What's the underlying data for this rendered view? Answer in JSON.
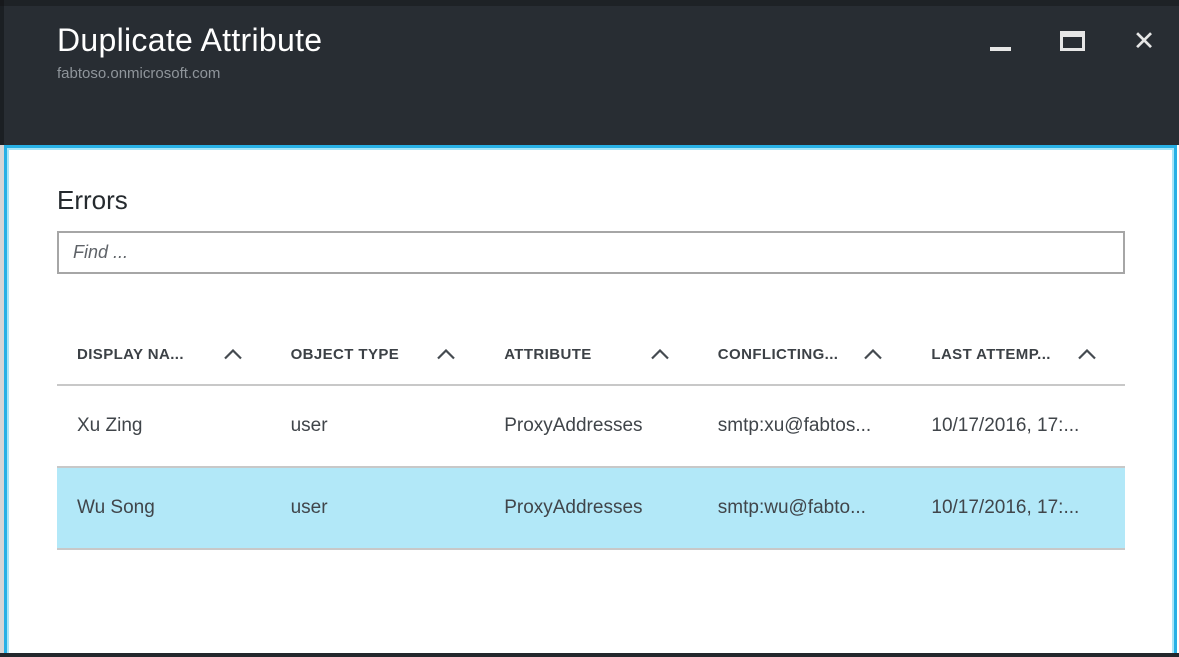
{
  "window": {
    "title": "Duplicate Attribute",
    "subtitle": "fabtoso.onmicrosoft.com",
    "controls": {
      "minimize": "minimize-icon",
      "maximize": "maximize-icon",
      "close": "close-icon",
      "close_glyph": "✕"
    }
  },
  "panel": {
    "heading": "Errors",
    "search": {
      "placeholder": "Find ...",
      "value": ""
    }
  },
  "table": {
    "columns": [
      {
        "label": "DISPLAY NA...",
        "sort_icon": "chevron-up-icon"
      },
      {
        "label": "OBJECT TYPE",
        "sort_icon": "chevron-up-icon"
      },
      {
        "label": "ATTRIBUTE",
        "sort_icon": "chevron-up-icon"
      },
      {
        "label": "CONFLICTING...",
        "sort_icon": "chevron-up-icon"
      },
      {
        "label": "LAST ATTEMP...",
        "sort_icon": "chevron-up-icon"
      }
    ],
    "rows": [
      {
        "display_name": "Xu Zing",
        "object_type": "user",
        "attribute": "ProxyAddresses",
        "conflicting_value": "smtp:xu@fabtos...",
        "last_attempt": "10/17/2016, 17:...",
        "selected": false
      },
      {
        "display_name": "Wu Song",
        "object_type": "user",
        "attribute": "ProxyAddresses",
        "conflicting_value": "smtp:wu@fabto...",
        "last_attempt": "10/17/2016, 17:...",
        "selected": true
      }
    ]
  },
  "colors": {
    "titlebar_bg": "#282d33",
    "top_strip": "#1e2226",
    "accent_border": "#27b0e5",
    "accent_border_inner": "#a7e6f8",
    "selected_row_bg": "#b2e8f8",
    "row_separator": "#c8c8c8",
    "control_icon": "#e6e6e6"
  }
}
